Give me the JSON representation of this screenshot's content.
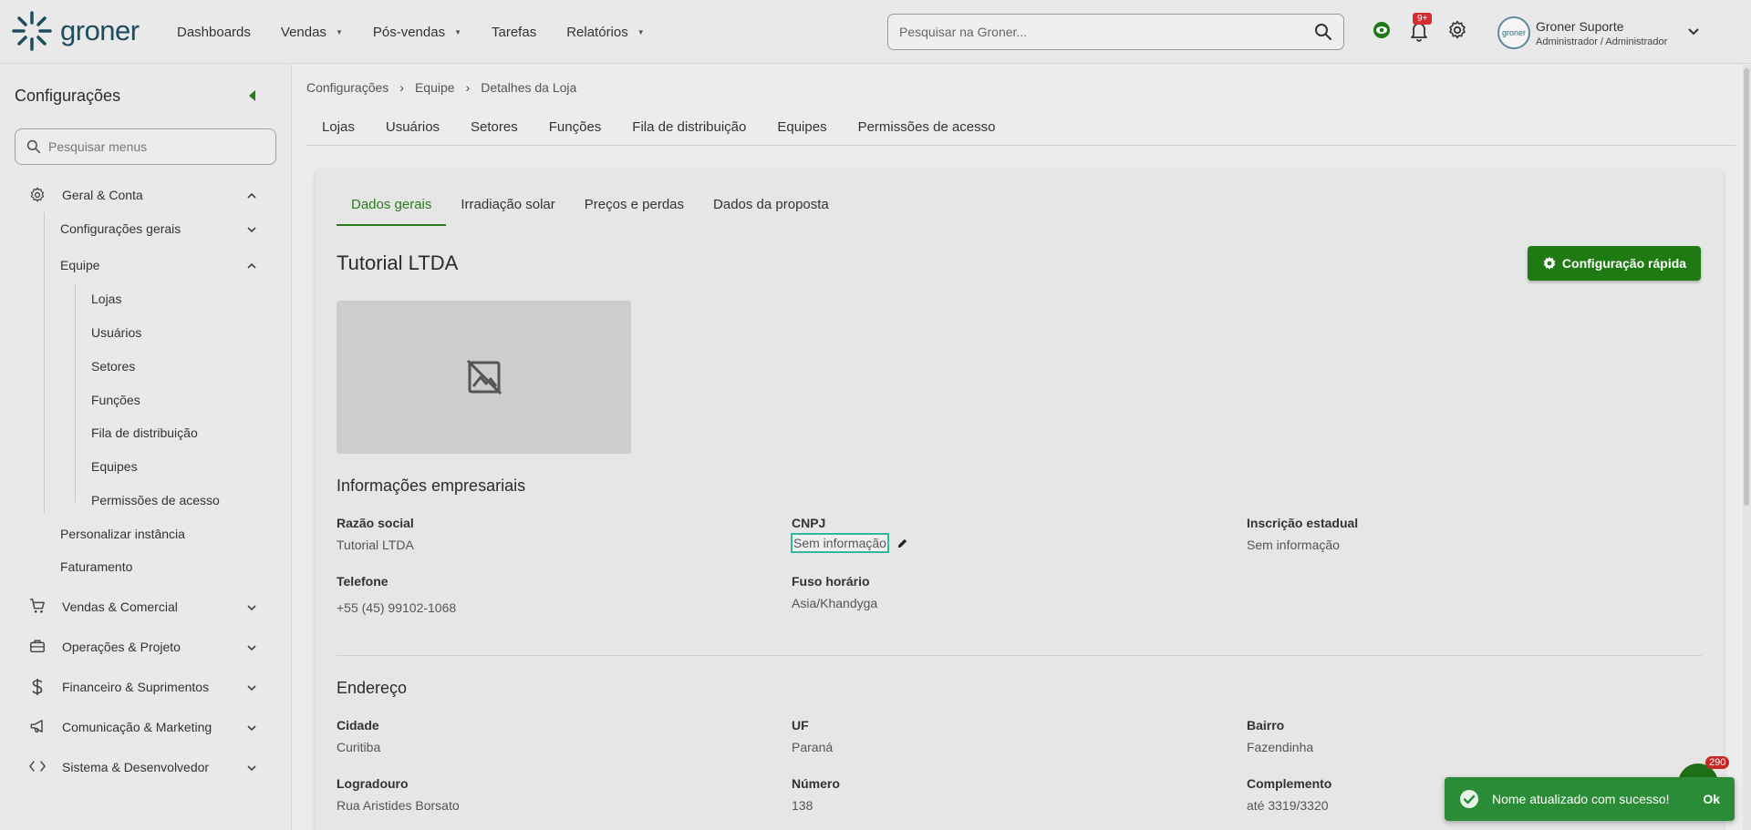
{
  "app": {
    "logo_text": "groner",
    "brand_color": "#1f7a13",
    "accent_color": "#2fb9a0"
  },
  "nav": {
    "items": [
      {
        "label": "Dashboards",
        "has_menu": false
      },
      {
        "label": "Vendas",
        "has_menu": true
      },
      {
        "label": "Pós-vendas",
        "has_menu": true
      },
      {
        "label": "Tarefas",
        "has_menu": false
      },
      {
        "label": "Relatórios",
        "has_menu": true
      }
    ]
  },
  "search": {
    "placeholder": "Pesquisar na Groner..."
  },
  "notifications": {
    "badge": "9+"
  },
  "user": {
    "name": "Groner Suporte",
    "role": "Administrador / Administrador",
    "avatar_text": "groner"
  },
  "sidebar": {
    "title": "Configurações",
    "search_placeholder": "Pesquisar menus",
    "groups": [
      {
        "label": "Geral & Conta",
        "icon": "gear-icon",
        "expanded": true
      },
      {
        "label": "Vendas & Comercial",
        "icon": "cart-icon",
        "expanded": false
      },
      {
        "label": "Operações & Projeto",
        "icon": "briefcase-icon",
        "expanded": false
      },
      {
        "label": "Financeiro & Suprimentos",
        "icon": "dollar-icon",
        "expanded": false
      },
      {
        "label": "Comunicação & Marketing",
        "icon": "megaphone-icon",
        "expanded": false
      },
      {
        "label": "Sistema & Desenvolvedor",
        "icon": "code-icon",
        "expanded": false
      }
    ],
    "geral_children": {
      "config_gerais": "Configurações gerais",
      "equipe": "Equipe",
      "personalizar": "Personalizar instância",
      "faturamento": "Faturamento"
    },
    "equipe_children": [
      "Lojas",
      "Usuários",
      "Setores",
      "Funções",
      "Fila de distribuição",
      "Equipes",
      "Permissões de acesso"
    ]
  },
  "breadcrumb": [
    "Configurações",
    "Equipe",
    "Detalhes da Loja"
  ],
  "tabs": [
    "Lojas",
    "Usuários",
    "Setores",
    "Funções",
    "Fila de distribuição",
    "Equipes",
    "Permissões de acesso"
  ],
  "detail": {
    "subtabs": [
      "Dados gerais",
      "Irradiação solar",
      "Preços e perdas",
      "Dados da proposta"
    ],
    "active_subtab": "Dados gerais",
    "store_name": "Tutorial LTDA",
    "quick_config_label": "Configuração rápida",
    "business_title": "Informações empresariais",
    "fields": {
      "razao_label": "Razão social",
      "razao_value": "Tutorial LTDA",
      "cnpj_label": "CNPJ",
      "cnpj_value": "Sem informação",
      "ie_label": "Inscrição estadual",
      "ie_value": "Sem informação",
      "telefone_label": "Telefone",
      "telefone_value": "+55 (45) 99102-1068",
      "fuso_label": "Fuso horário",
      "fuso_value": "Asia/Khandyga"
    },
    "address_title": "Endereço",
    "address": {
      "cidade_label": "Cidade",
      "cidade_value": "Curitiba",
      "uf_label": "UF",
      "uf_value": "Paraná",
      "bairro_label": "Bairro",
      "bairro_value": "Fazendinha",
      "logradouro_label": "Logradouro",
      "logradouro_value": "Rua Aristides Borsato",
      "numero_label": "Número",
      "numero_value": "138",
      "complemento_label": "Complemento",
      "complemento_value": "até 3319/3320"
    }
  },
  "toast": {
    "message": "Nome atualizado com sucesso!",
    "action": "Ok"
  },
  "chat": {
    "badge": "290"
  }
}
